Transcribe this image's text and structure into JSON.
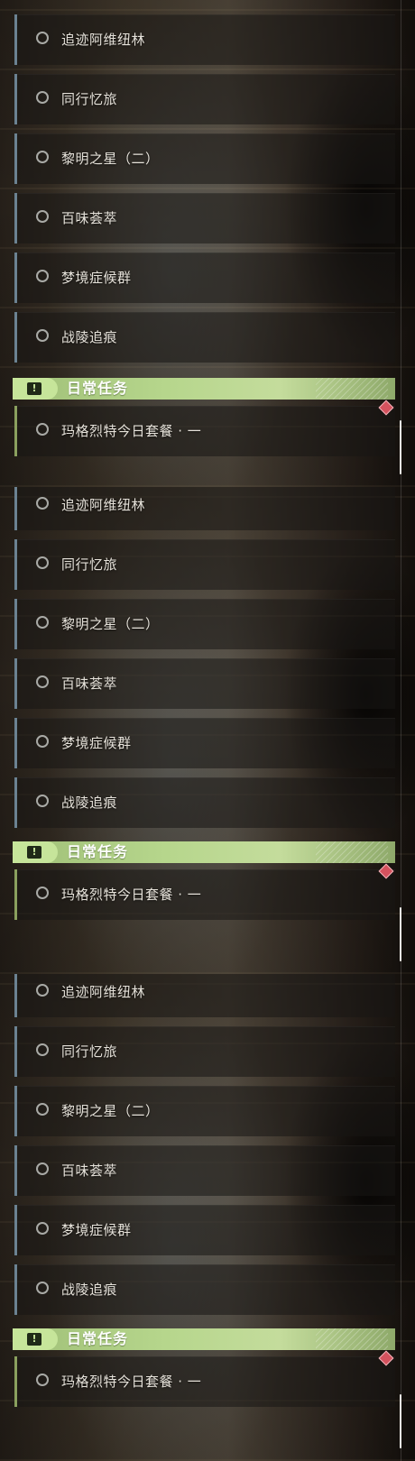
{
  "panels": [
    {
      "quests": [
        "追迹阿维纽林",
        "同行忆旅",
        "黎明之星（二）",
        "百味荟萃",
        "梦境症候群",
        "战陵追痕"
      ],
      "section_title": "日常任务",
      "daily_quest": "玛格烈特今日套餐 · 一"
    },
    {
      "quests": [
        "追迹阿维纽林",
        "同行忆旅",
        "黎明之星（二）",
        "百味荟萃",
        "梦境症候群",
        "战陵追痕"
      ],
      "section_title": "日常任务",
      "daily_quest": "玛格烈特今日套餐 · 一"
    },
    {
      "quests": [
        "追迹阿维纽林",
        "同行忆旅",
        "黎明之星（二）",
        "百味荟萃",
        "梦境症候群",
        "战陵追痕"
      ],
      "section_title": "日常任务",
      "daily_quest": "玛格烈特今日套餐 · 一"
    }
  ],
  "icons": {
    "quest_status": "empty-circle-icon",
    "section": "exclamation-icon",
    "tracking": "diamond-marker-icon"
  },
  "colors": {
    "quest_bar": "#6b8292",
    "daily_bar": "#8aa05e",
    "section_header": "#b6d68c",
    "marker": "#d4525e"
  }
}
